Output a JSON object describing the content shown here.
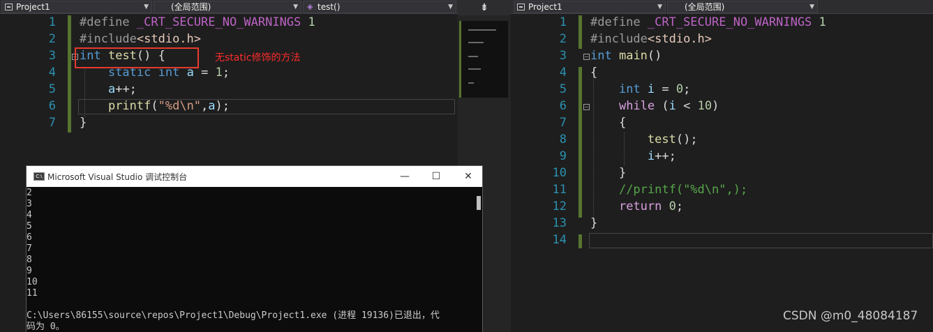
{
  "left_editor": {
    "nav": {
      "project": "Project1",
      "scope": "(全局范围)",
      "function": "test()"
    },
    "line_numbers": [
      "1",
      "2",
      "3",
      "4",
      "5",
      "6",
      "7"
    ],
    "lines": [
      [
        {
          "t": "#define ",
          "c": "pp"
        },
        {
          "t": "_CRT_SECURE_NO_WARNINGS",
          "c": "mac"
        },
        {
          "t": " 1",
          "c": "num"
        }
      ],
      [
        {
          "t": "#include",
          "c": "pp"
        },
        {
          "t": "<stdio.h>",
          "c": "inc"
        }
      ],
      [
        {
          "t": "int",
          "c": "kw"
        },
        {
          "t": " "
        },
        {
          "t": "test",
          "c": "fn"
        },
        {
          "t": "() {"
        }
      ],
      [
        {
          "t": "    "
        },
        {
          "t": "static",
          "c": "kw"
        },
        {
          "t": " "
        },
        {
          "t": "int",
          "c": "kw"
        },
        {
          "t": " "
        },
        {
          "t": "a",
          "c": "var"
        },
        {
          "t": " = "
        },
        {
          "t": "1",
          "c": "num"
        },
        {
          "t": ";"
        }
      ],
      [
        {
          "t": "    "
        },
        {
          "t": "a",
          "c": "var"
        },
        {
          "t": "++;"
        }
      ],
      [
        {
          "t": "    "
        },
        {
          "t": "printf",
          "c": "fn"
        },
        {
          "t": "("
        },
        {
          "t": "\"%d\\n\"",
          "c": "str"
        },
        {
          "t": ","
        },
        {
          "t": "a",
          "c": "var"
        },
        {
          "t": ");"
        }
      ],
      [
        {
          "t": "}"
        }
      ]
    ],
    "annotation": "无static修饰的方法"
  },
  "right_editor": {
    "nav": {
      "project": "Project1",
      "scope": "(全局范围)"
    },
    "line_numbers": [
      "1",
      "2",
      "3",
      "4",
      "5",
      "6",
      "7",
      "8",
      "9",
      "10",
      "11",
      "12",
      "13",
      "14"
    ],
    "lines": [
      [
        {
          "t": "#define ",
          "c": "pp"
        },
        {
          "t": "_CRT_SECURE_NO_WARNINGS",
          "c": "mac"
        },
        {
          "t": " 1",
          "c": "num"
        }
      ],
      [
        {
          "t": "#include",
          "c": "pp"
        },
        {
          "t": "<stdio.h>",
          "c": "inc"
        }
      ],
      [
        {
          "t": "int",
          "c": "kw"
        },
        {
          "t": " "
        },
        {
          "t": "main",
          "c": "fn"
        },
        {
          "t": "()"
        }
      ],
      [
        {
          "t": "{"
        }
      ],
      [
        {
          "t": "    "
        },
        {
          "t": "int",
          "c": "kw"
        },
        {
          "t": " "
        },
        {
          "t": "i",
          "c": "var"
        },
        {
          "t": " = "
        },
        {
          "t": "0",
          "c": "num"
        },
        {
          "t": ";"
        }
      ],
      [
        {
          "t": "    "
        },
        {
          "t": "while",
          "c": "ctl"
        },
        {
          "t": " ("
        },
        {
          "t": "i",
          "c": "var"
        },
        {
          "t": " < "
        },
        {
          "t": "10",
          "c": "num"
        },
        {
          "t": ")"
        }
      ],
      [
        {
          "t": "    {"
        }
      ],
      [
        {
          "t": "        "
        },
        {
          "t": "test",
          "c": "fn"
        },
        {
          "t": "();"
        }
      ],
      [
        {
          "t": "        "
        },
        {
          "t": "i",
          "c": "var"
        },
        {
          "t": "++;"
        }
      ],
      [
        {
          "t": "    }"
        }
      ],
      [
        {
          "t": "    "
        },
        {
          "t": "//printf(\"%d\\n\",);",
          "c": "cmt"
        }
      ],
      [
        {
          "t": "    "
        },
        {
          "t": "return",
          "c": "ctl"
        },
        {
          "t": " "
        },
        {
          "t": "0",
          "c": "num"
        },
        {
          "t": ";"
        }
      ],
      [
        {
          "t": "}"
        }
      ],
      [
        {
          "t": ""
        }
      ]
    ]
  },
  "console": {
    "title": "Microsoft Visual Studio 调试控制台",
    "icon_text": "C:\\",
    "minimize": "—",
    "maximize": "☐",
    "close": "✕",
    "output": [
      "2",
      "3",
      "4",
      "5",
      "6",
      "7",
      "8",
      "9",
      "10",
      "11",
      "",
      "C:\\Users\\86155\\source\\repos\\Project1\\Debug\\Project1.exe (进程 19136)已退出，代",
      "码为 0。"
    ]
  },
  "splitter": {
    "icon": "⇟"
  },
  "watermark": "CSDN @m0_48084187",
  "colors": {
    "keyword": "#569cd6",
    "function": "#dcdcaa",
    "string": "#d69d85",
    "number": "#b5cea8",
    "comment": "#57a64a",
    "annotation": "#ff2b2b"
  }
}
